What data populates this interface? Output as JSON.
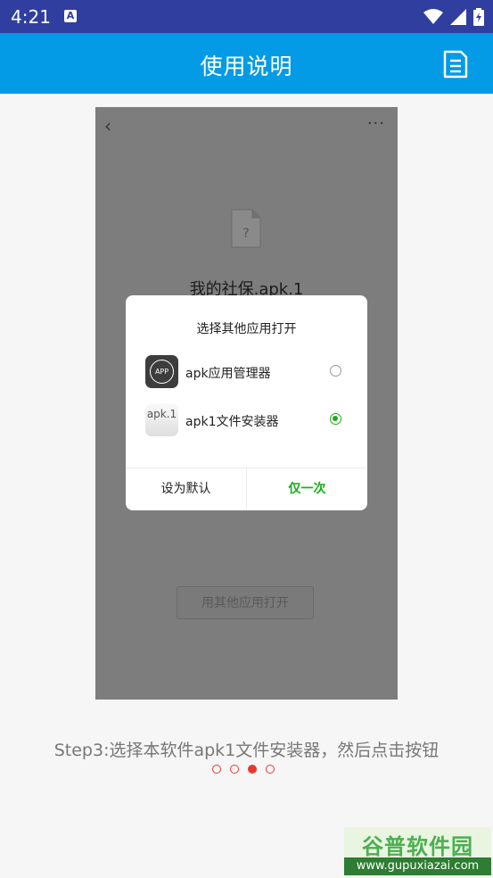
{
  "status_bar": {
    "time": "4:21",
    "notification_badge": "A",
    "icons": [
      "wifi-icon",
      "signal-icon",
      "battery-icon"
    ]
  },
  "app_bar": {
    "title": "使用说明",
    "action_icon": "document-list-icon",
    "background": "#039be5"
  },
  "screenshot": {
    "back_glyph": "‹",
    "more_glyph": "···",
    "file_icon_glyph": "?",
    "file_name": "我的社保.apk.1",
    "open_with_button": "用其他应用打开"
  },
  "dialog": {
    "title": "选择其他应用打开",
    "options": [
      {
        "icon_text": "APP",
        "label": "apk应用管理器",
        "selected": false
      },
      {
        "icon_text": "apk.1",
        "label": "apk1文件安装器",
        "selected": true
      }
    ],
    "buttons": {
      "set_default": "设为默认",
      "once": "仅一次"
    },
    "accent": "#1aad19"
  },
  "caption": "Step3:选择本软件apk1文件安装器，然后点击按钮",
  "pager": {
    "total": 4,
    "current": 3,
    "color": "#e53935"
  },
  "watermark": {
    "brand": "谷普软件园",
    "url": "www.gupuxiazai.com"
  }
}
